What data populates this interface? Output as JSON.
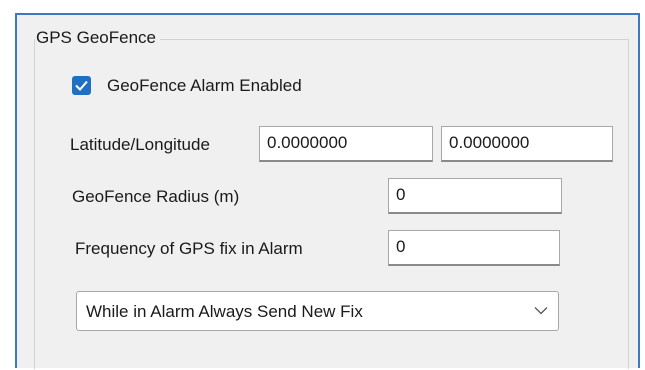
{
  "group": {
    "title": "GPS GeoFence"
  },
  "alarm_enabled": {
    "label": "GeoFence Alarm Enabled",
    "checked": true
  },
  "lat_lon": {
    "label": "Latitude/Longitude",
    "latitude": "0.0000000",
    "longitude": "0.0000000"
  },
  "radius": {
    "label": "GeoFence Radius (m)",
    "value": "0"
  },
  "frequency": {
    "label": "Frequency of GPS fix in Alarm",
    "value": "0"
  },
  "alarm_mode": {
    "selected": "While in Alarm Always Send New Fix"
  },
  "colors": {
    "accent": "#1f6fc4",
    "frame_border": "#3c78c4",
    "panel_bg": "#f0f0f0"
  },
  "icons": {
    "checkbox": "checkmark-icon",
    "dropdown": "chevron-down-icon"
  }
}
